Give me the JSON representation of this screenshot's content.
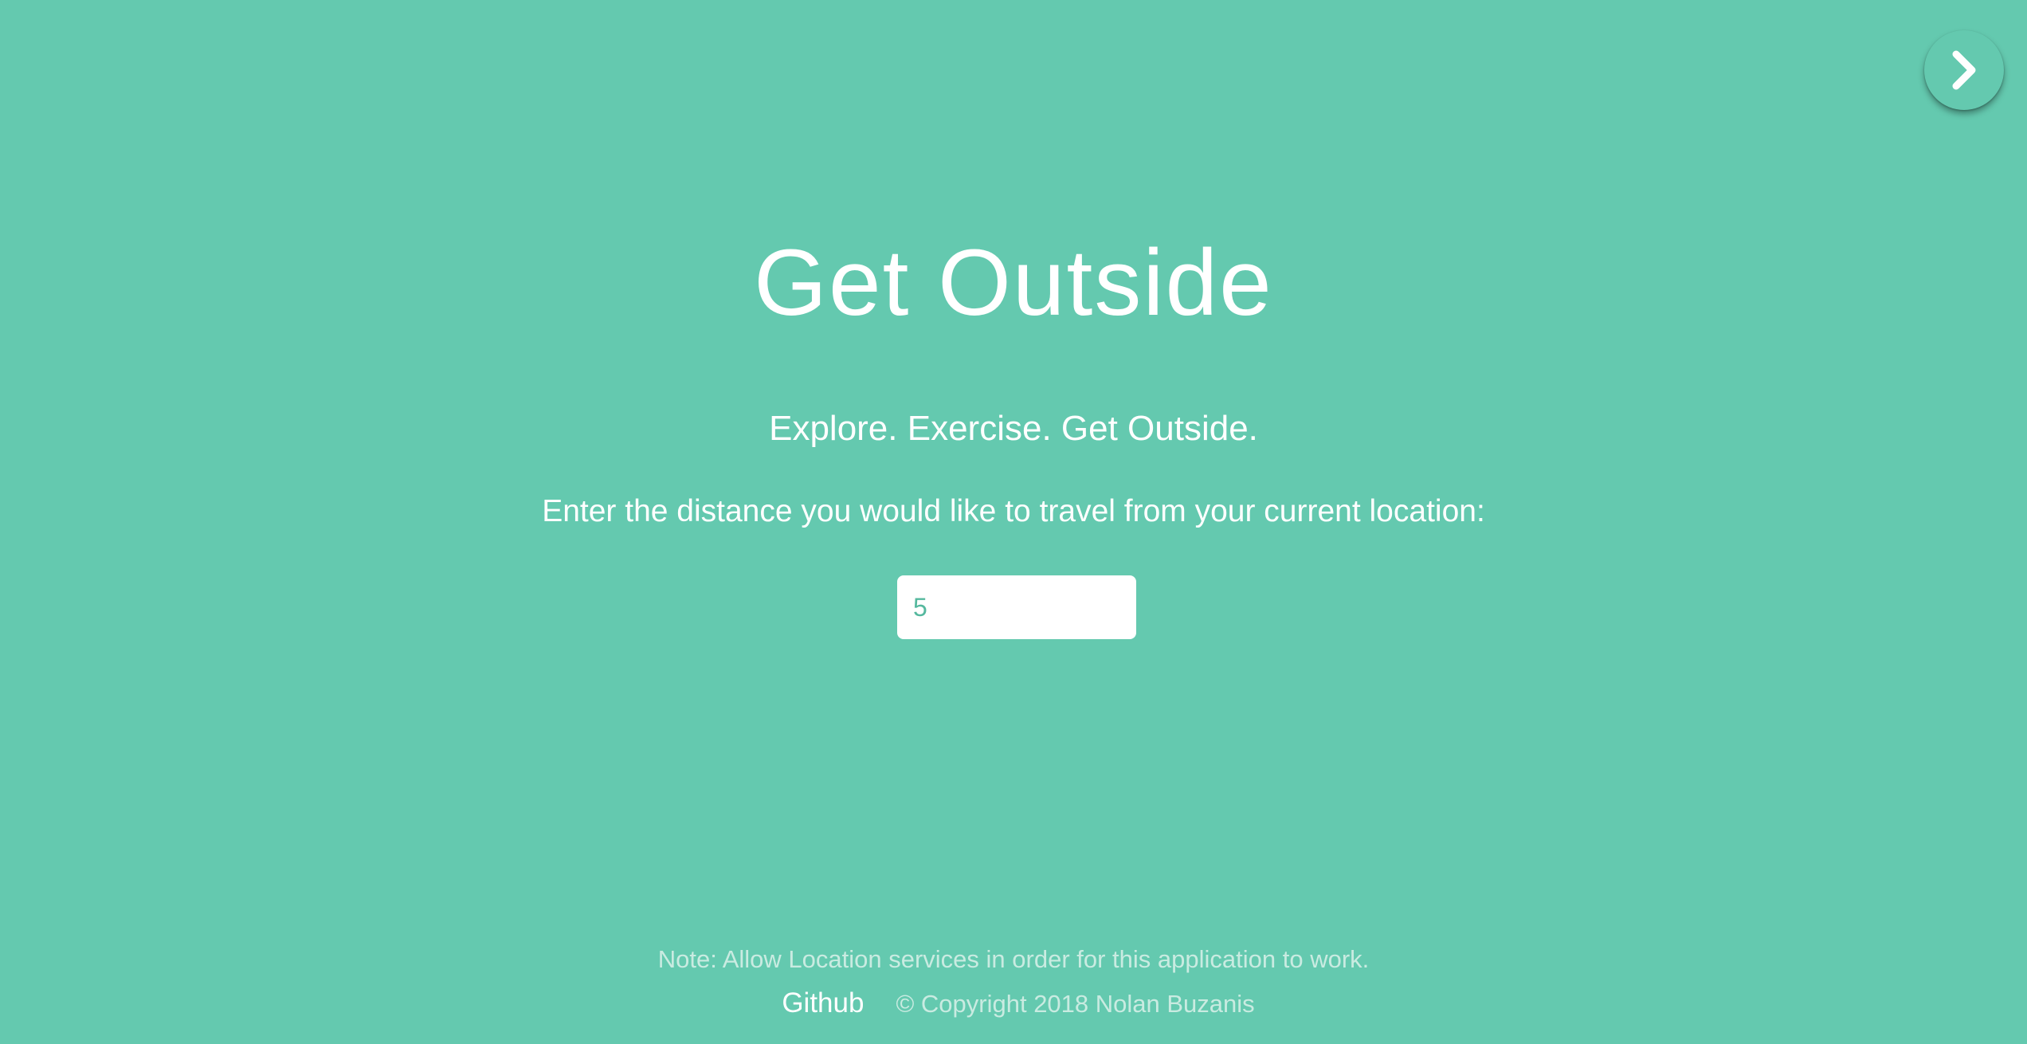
{
  "nav": {
    "next_icon": "chevron-right-icon"
  },
  "main": {
    "title": "Get Outside",
    "tagline": "Explore. Exercise. Get Outside.",
    "instructions": "Enter the distance you would like to travel from your current location:",
    "distance_input": {
      "value": "5"
    }
  },
  "footer": {
    "note": "Note: Allow Location services in order for this application to work.",
    "github_label": "Github",
    "copyright": "© Copyright 2018 Nolan Buzanis"
  },
  "colors": {
    "background": "#64c9af",
    "text": "#ffffff",
    "muted_text": "#c9ebe1",
    "input_text": "#55b89e"
  }
}
